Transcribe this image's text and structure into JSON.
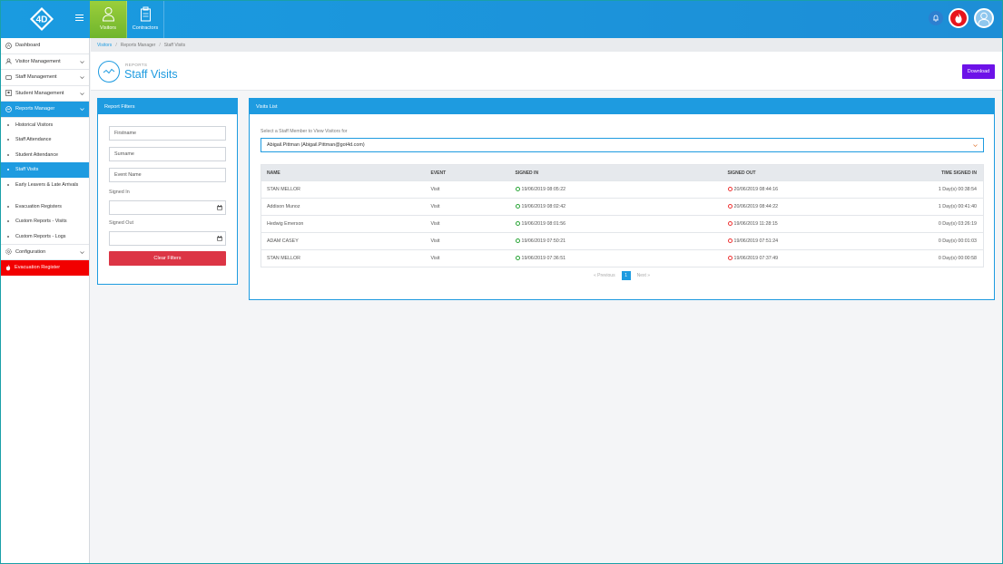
{
  "brand": {
    "logo_text": "4D"
  },
  "topnav": [
    {
      "label": "Visitors",
      "icon": "visitor-icon",
      "active": true
    },
    {
      "label": "Contractors",
      "icon": "clipboard-icon",
      "active": false
    }
  ],
  "sidebar": {
    "items": [
      {
        "label": "Dashboard",
        "icon": "home-icon"
      },
      {
        "label": "Visitor Management",
        "icon": "user-icon",
        "chevron": true
      },
      {
        "label": "Staff Management",
        "icon": "staff-icon",
        "chevron": true
      },
      {
        "label": "Student Management",
        "icon": "student-icon",
        "chevron": true
      },
      {
        "label": "Reports Manager",
        "icon": "reports-icon",
        "chevron": true,
        "active": true
      }
    ],
    "sub_items": [
      "Historical Visitors",
      "Staff Attendance",
      "Student Attendance",
      "Staff Visits",
      "Early Leavers & Late Arrivals",
      "Evacuation Registers",
      "Custom Reports - Visits",
      "Custom Reports - Logs"
    ],
    "config_label": "Configuration",
    "evac_label": "Evacuation Register"
  },
  "breadcrumb": {
    "first": "Visitors",
    "second": "Reports Manager",
    "third": "Staff Visits"
  },
  "header": {
    "subtitle": "REPORTS",
    "title": "Staff Visits",
    "download_label": "Download"
  },
  "filters": {
    "title": "Report Filters",
    "firstname_placeholder": "Firstname",
    "surname_placeholder": "Surname",
    "event_placeholder": "Event Name",
    "signed_in_label": "Signed In",
    "signed_out_label": "Signed Out",
    "clear_label": "Clear Filters"
  },
  "visits": {
    "title": "Visits List",
    "select_label": "Select a Staff Member to View Visitors for",
    "selected_staff": "Abigail.Pittman (Abigail.Pittman@got4d.com)",
    "columns": [
      "NAME",
      "EVENT",
      "SIGNED IN",
      "SIGNED OUT",
      "TIME SIGNED IN"
    ],
    "rows": [
      [
        "STAN MELLOR",
        "Visit",
        "19/06/2019 08:05:22",
        "20/06/2019 08:44:16",
        "1 Day(s) 00:38:54"
      ],
      [
        "Addison Munoz",
        "Visit",
        "19/06/2019 08:02:42",
        "20/06/2019 08:44:22",
        "1 Day(s) 00:41:40"
      ],
      [
        "Hedwig Emerson",
        "Visit",
        "19/06/2019 08:01:56",
        "19/06/2019 11:28:15",
        "0 Day(s) 03:26:19"
      ],
      [
        "ADAM CASEY",
        "Visit",
        "19/06/2019 07:50:21",
        "19/06/2019 07:51:24",
        "0 Day(s) 00:01:03"
      ],
      [
        "STAN MELLOR",
        "Visit",
        "19/06/2019 07:36:51",
        "19/06/2019 07:37:49",
        "0 Day(s) 00:00:58"
      ]
    ],
    "pager": {
      "prev": "« Previous",
      "page": "1",
      "next": "Next »"
    }
  }
}
